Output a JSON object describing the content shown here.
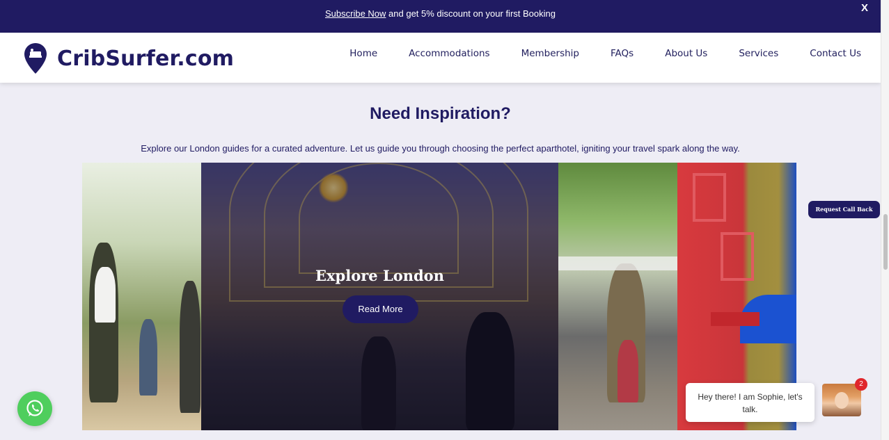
{
  "promo": {
    "link_text": "Subscribe Now",
    "rest_text": " and get 5% discount on your first Booking",
    "close_label": "X"
  },
  "header": {
    "logo_text": "CribSurfer.com",
    "nav": [
      "Home",
      "Accommodations",
      "Membership",
      "FAQs",
      "About Us",
      "Services",
      "Contact Us"
    ]
  },
  "main": {
    "heading": "Need Inspiration?",
    "subtext": "Explore our London guides for a curated adventure. Let us guide you through choosing the perfect aparthotel, igniting your travel spark along the way.",
    "featured_title": "Explore London",
    "read_more_label": "Read More"
  },
  "widgets": {
    "callback_label": "Request Call Back",
    "chat_message": "Hey there! I am Sophie, let's talk.",
    "chat_badge_count": "2",
    "whatsapp_icon": "whatsapp-icon"
  },
  "colors": {
    "brand": "#201b62",
    "page_background": "#eeedf5",
    "whatsapp": "#4fce5d",
    "badge": "#e0262c"
  }
}
